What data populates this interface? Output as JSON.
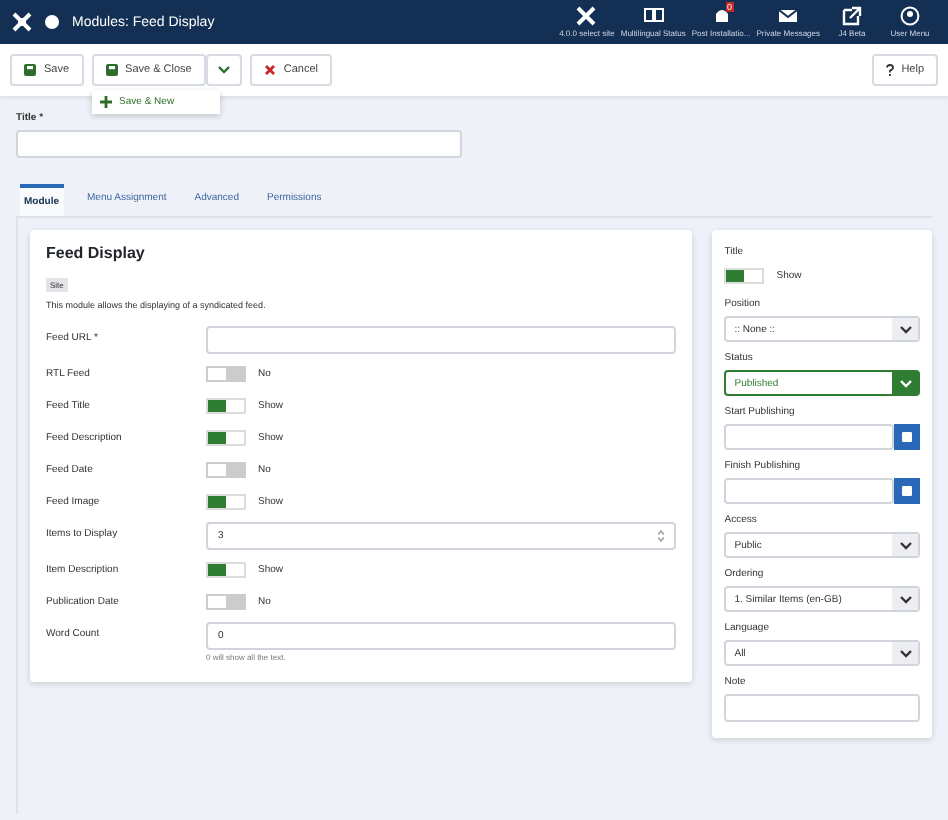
{
  "header": {
    "title": "Modules: Feed Display",
    "items": [
      {
        "label": "4.0.0 select site",
        "kind": "site"
      },
      {
        "label": "Multilingual Status",
        "kind": "multilingual"
      },
      {
        "label": "Post Installatio...",
        "kind": "bell",
        "badge": "0"
      },
      {
        "label": "Private Messages",
        "kind": "mail"
      },
      {
        "label": "J4 Beta",
        "kind": "external"
      },
      {
        "label": "User Menu",
        "kind": "user"
      }
    ]
  },
  "toolbar": {
    "buttons": [
      {
        "label": "Save",
        "kind": "save"
      },
      {
        "label": "Save & Close",
        "kind": "save-close"
      },
      {
        "label": "Cancel",
        "kind": "cancel"
      }
    ],
    "menu": [
      {
        "label": "Save & New"
      }
    ],
    "help": "Help"
  },
  "title_field": {
    "label": "Title *"
  },
  "tabs": [
    {
      "label": "Module",
      "selected": true
    },
    {
      "label": "Menu Assignment",
      "selected": false
    },
    {
      "label": "Advanced",
      "selected": false
    },
    {
      "label": "Permissions",
      "selected": false
    }
  ],
  "module": {
    "title": "Feed Display",
    "badge": "Site",
    "description": "This module allows the displaying of a syndicated feed.",
    "fields": [
      {
        "label": "Feed URL *",
        "kind": "text"
      },
      {
        "label": "RTL Feed",
        "kind": "toggle",
        "on": false,
        "text": "No"
      },
      {
        "label": "Feed Title",
        "kind": "toggle",
        "on": true,
        "text": "Show"
      },
      {
        "label": "Feed Description",
        "kind": "toggle",
        "on": true,
        "text": "Show"
      },
      {
        "label": "Feed Date",
        "kind": "toggle",
        "on": false,
        "text": "No"
      },
      {
        "label": "Feed Image",
        "kind": "toggle",
        "on": true,
        "text": "Show"
      },
      {
        "label": "Items to Display",
        "kind": "number",
        "value": "3"
      },
      {
        "label": "Item Description",
        "kind": "toggle",
        "on": true,
        "text": "Show"
      },
      {
        "label": "Publication Date",
        "kind": "toggle",
        "on": false,
        "text": "No"
      },
      {
        "label": "Word Count",
        "kind": "text",
        "value": "0",
        "hint": "0 will show all the text."
      }
    ]
  },
  "sidebar": {
    "fields": [
      {
        "label": "Title",
        "kind": "toggle",
        "on": true,
        "text": "Show"
      },
      {
        "label": "Position",
        "kind": "select",
        "value": ":: None ::"
      },
      {
        "label": "Status",
        "kind": "status",
        "value": "Published"
      },
      {
        "label": "Start Publishing",
        "kind": "date"
      },
      {
        "label": "Finish Publishing",
        "kind": "date"
      },
      {
        "label": "Access",
        "kind": "select",
        "value": "Public"
      },
      {
        "label": "Ordering",
        "kind": "select",
        "value": "1. Similar Items (en-GB)"
      },
      {
        "label": "Language",
        "kind": "select",
        "value": "All"
      },
      {
        "label": "Note",
        "kind": "text"
      }
    ]
  }
}
